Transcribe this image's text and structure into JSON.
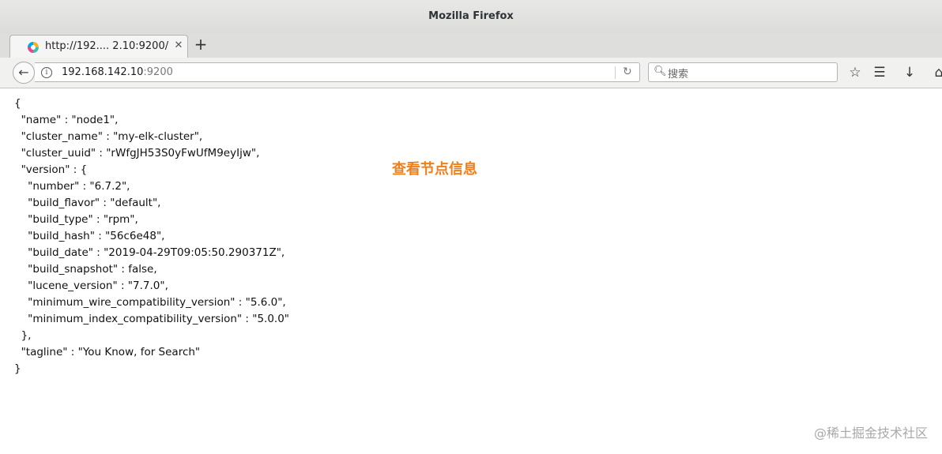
{
  "window": {
    "title": "Mozilla Firefox"
  },
  "tabs": [
    {
      "title": "http://192.... 2.10:9200/",
      "favicon": "elasticsearch-icon",
      "close_label": "✕"
    }
  ],
  "toolbar": {
    "new_tab_label": "+",
    "url_host": "192.168.142.10",
    "url_port": ":9200",
    "search_placeholder": "搜索"
  },
  "page": {
    "json_text": "{\n  \"name\" : \"node1\",\n  \"cluster_name\" : \"my-elk-cluster\",\n  \"cluster_uuid\" : \"rWfgJH53S0yFwUfM9eyIjw\",\n  \"version\" : {\n    \"number\" : \"6.7.2\",\n    \"build_flavor\" : \"default\",\n    \"build_type\" : \"rpm\",\n    \"build_hash\" : \"56c6e48\",\n    \"build_date\" : \"2019-04-29T09:05:50.290371Z\",\n    \"build_snapshot\" : false,\n    \"lucene_version\" : \"7.7.0\",\n    \"minimum_wire_compatibility_version\" : \"5.6.0\",\n    \"minimum_index_compatibility_version\" : \"5.0.0\"\n  },\n  \"tagline\" : \"You Know, for Search\"\n}",
    "annotation": "查看节点信息",
    "watermark": "@稀土掘金技术社区"
  },
  "colors": {
    "annotation": "#f07f1a",
    "watermark": "#a8a8a8"
  }
}
